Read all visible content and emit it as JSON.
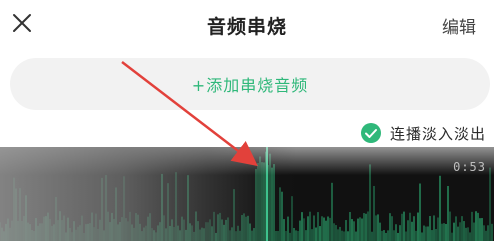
{
  "header": {
    "title": "音频串烧",
    "edit_label": "编辑",
    "close_icon": "close-icon"
  },
  "add_button": {
    "label": "+添加串烧音频"
  },
  "crossfade": {
    "label": "连播淡入淡出",
    "checked": true,
    "icon": "check-circle-icon"
  },
  "waveform": {
    "duration": "0:53"
  },
  "colors": {
    "accent": "#2fb87a",
    "waveform_bg": "#111111",
    "annotation": "#e2413b"
  }
}
